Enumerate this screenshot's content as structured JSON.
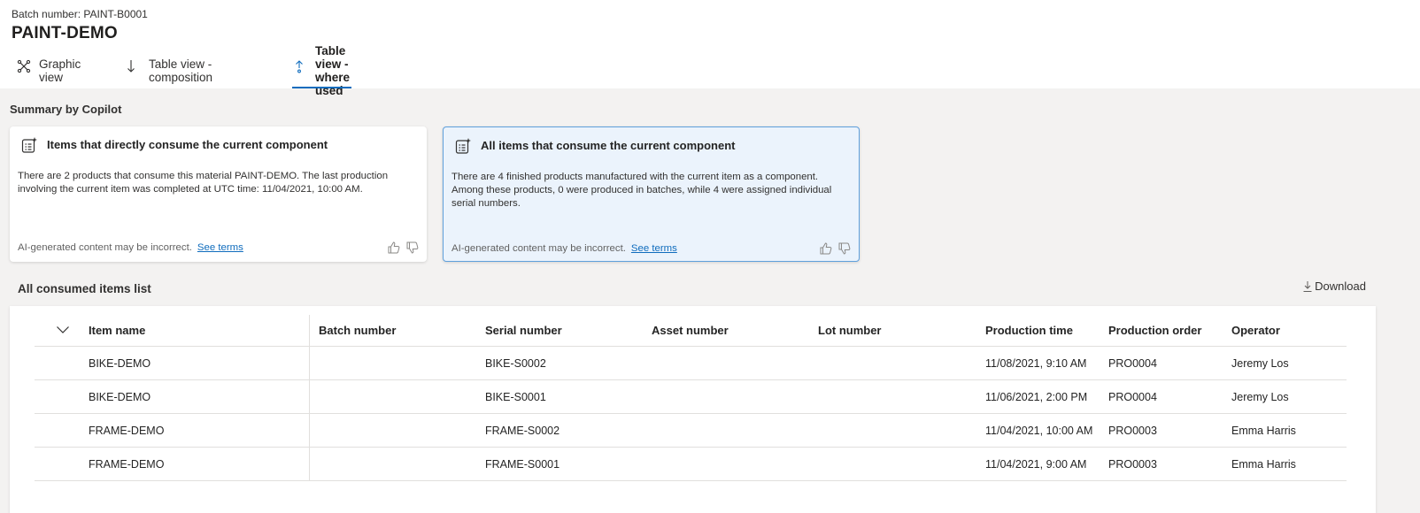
{
  "header": {
    "batch_label": "Batch number: PAINT-B0001",
    "title": "PAINT-DEMO"
  },
  "tabs": [
    {
      "label": "Graphic view",
      "icon": "graph-nodes-icon",
      "active": false
    },
    {
      "label": "Table view - composition",
      "icon": "arrow-down-icon",
      "active": false
    },
    {
      "label": "Table view - where used",
      "icon": "arrow-up-icon",
      "active": true
    }
  ],
  "copilot": {
    "heading": "Summary by Copilot",
    "cards": [
      {
        "title": "Items that directly consume the current component",
        "body": "There are 2 products that consume this material PAINT-DEMO. The last production involving the current item was completed at UTC time: 11/04/2021, 10:00 AM.",
        "disclaimer": "AI-generated content may be incorrect.",
        "link": "See terms",
        "selected": false
      },
      {
        "title": "All items that consume the current component",
        "body": "There are 4 finished products manufactured with the current item as a component. Among these products, 0 were produced in batches, while 4 were assigned individual serial numbers.",
        "disclaimer": "AI-generated content may be incorrect.",
        "link": "See terms",
        "selected": true
      }
    ]
  },
  "list": {
    "heading": "All consumed items list",
    "download_label": "Download",
    "columns": [
      "Item name",
      "Batch number",
      "Serial number",
      "Asset number",
      "Lot number",
      "Production time",
      "Production order",
      "Operator"
    ],
    "rows": [
      [
        "BIKE-DEMO",
        "",
        "BIKE-S0002",
        "",
        "",
        "11/08/2021, 9:10 AM",
        "PRO0004",
        "Jeremy Los"
      ],
      [
        "BIKE-DEMO",
        "",
        "BIKE-S0001",
        "",
        "",
        "11/06/2021, 2:00 PM",
        "PRO0004",
        "Jeremy Los"
      ],
      [
        "FRAME-DEMO",
        "",
        "FRAME-S0002",
        "",
        "",
        "11/04/2021, 10:00 AM",
        "PRO0003",
        "Emma Harris"
      ],
      [
        "FRAME-DEMO",
        "",
        "FRAME-S0001",
        "",
        "",
        "11/04/2021, 9:00 AM",
        "PRO0003",
        "Emma Harris"
      ]
    ]
  },
  "colors": {
    "accent": "#0f6cbd",
    "selected_card_bg": "#ebf3fc",
    "page_bg": "#f3f2f1"
  }
}
